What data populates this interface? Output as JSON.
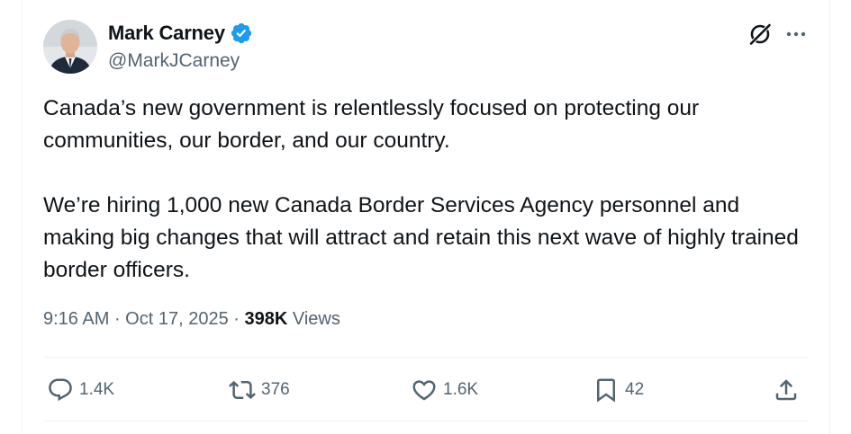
{
  "post": {
    "author": {
      "name": "Mark Carney",
      "handle": "@MarkJCarney",
      "verified": true
    },
    "paragraphs": [
      "Canada’s new government is relentlessly focused on protecting our communities, our border, and our country.",
      "We’re hiring 1,000 new Canada Border Services Agency personnel and making big changes that will attract and retain this next wave of highly trained border officers."
    ],
    "meta": {
      "time": "9:16 AM",
      "separator": " · ",
      "date": "Oct 17, 2025",
      "views_count": "398K",
      "views_label": "Views"
    },
    "actions": {
      "replies": "1.4K",
      "reposts": "376",
      "likes": "1.6K",
      "bookmarks": "42"
    }
  },
  "icons": {
    "verified": "verified-badge-icon",
    "grok": "grok-icon",
    "more": "more-icon",
    "reply": "reply-icon",
    "repost": "repost-icon",
    "like": "like-icon",
    "bookmark": "bookmark-icon",
    "share": "share-icon"
  },
  "colors": {
    "text_primary": "#0f1419",
    "text_secondary": "#536471",
    "verified": "#1d9bf0",
    "divider": "#eff3f4"
  }
}
